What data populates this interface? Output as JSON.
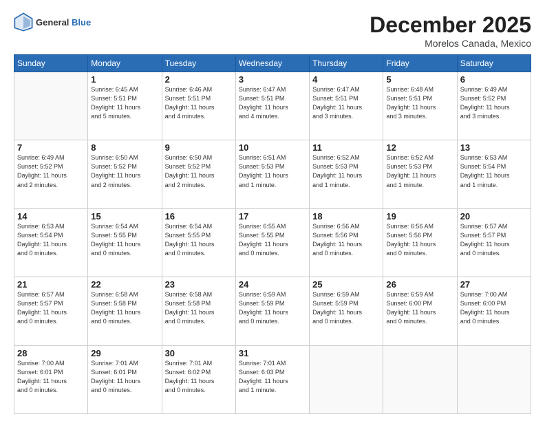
{
  "header": {
    "logo_general": "General",
    "logo_blue": "Blue",
    "month": "December 2025",
    "location": "Morelos Canada, Mexico"
  },
  "days_of_week": [
    "Sunday",
    "Monday",
    "Tuesday",
    "Wednesday",
    "Thursday",
    "Friday",
    "Saturday"
  ],
  "weeks": [
    [
      {
        "num": "",
        "info": ""
      },
      {
        "num": "1",
        "info": "Sunrise: 6:45 AM\nSunset: 5:51 PM\nDaylight: 11 hours\nand 5 minutes."
      },
      {
        "num": "2",
        "info": "Sunrise: 6:46 AM\nSunset: 5:51 PM\nDaylight: 11 hours\nand 4 minutes."
      },
      {
        "num": "3",
        "info": "Sunrise: 6:47 AM\nSunset: 5:51 PM\nDaylight: 11 hours\nand 4 minutes."
      },
      {
        "num": "4",
        "info": "Sunrise: 6:47 AM\nSunset: 5:51 PM\nDaylight: 11 hours\nand 3 minutes."
      },
      {
        "num": "5",
        "info": "Sunrise: 6:48 AM\nSunset: 5:51 PM\nDaylight: 11 hours\nand 3 minutes."
      },
      {
        "num": "6",
        "info": "Sunrise: 6:49 AM\nSunset: 5:52 PM\nDaylight: 11 hours\nand 3 minutes."
      }
    ],
    [
      {
        "num": "7",
        "info": "Sunrise: 6:49 AM\nSunset: 5:52 PM\nDaylight: 11 hours\nand 2 minutes."
      },
      {
        "num": "8",
        "info": "Sunrise: 6:50 AM\nSunset: 5:52 PM\nDaylight: 11 hours\nand 2 minutes."
      },
      {
        "num": "9",
        "info": "Sunrise: 6:50 AM\nSunset: 5:52 PM\nDaylight: 11 hours\nand 2 minutes."
      },
      {
        "num": "10",
        "info": "Sunrise: 6:51 AM\nSunset: 5:53 PM\nDaylight: 11 hours\nand 1 minute."
      },
      {
        "num": "11",
        "info": "Sunrise: 6:52 AM\nSunset: 5:53 PM\nDaylight: 11 hours\nand 1 minute."
      },
      {
        "num": "12",
        "info": "Sunrise: 6:52 AM\nSunset: 5:53 PM\nDaylight: 11 hours\nand 1 minute."
      },
      {
        "num": "13",
        "info": "Sunrise: 6:53 AM\nSunset: 5:54 PM\nDaylight: 11 hours\nand 1 minute."
      }
    ],
    [
      {
        "num": "14",
        "info": "Sunrise: 6:53 AM\nSunset: 5:54 PM\nDaylight: 11 hours\nand 0 minutes."
      },
      {
        "num": "15",
        "info": "Sunrise: 6:54 AM\nSunset: 5:55 PM\nDaylight: 11 hours\nand 0 minutes."
      },
      {
        "num": "16",
        "info": "Sunrise: 6:54 AM\nSunset: 5:55 PM\nDaylight: 11 hours\nand 0 minutes."
      },
      {
        "num": "17",
        "info": "Sunrise: 6:55 AM\nSunset: 5:55 PM\nDaylight: 11 hours\nand 0 minutes."
      },
      {
        "num": "18",
        "info": "Sunrise: 6:56 AM\nSunset: 5:56 PM\nDaylight: 11 hours\nand 0 minutes."
      },
      {
        "num": "19",
        "info": "Sunrise: 6:56 AM\nSunset: 5:56 PM\nDaylight: 11 hours\nand 0 minutes."
      },
      {
        "num": "20",
        "info": "Sunrise: 6:57 AM\nSunset: 5:57 PM\nDaylight: 11 hours\nand 0 minutes."
      }
    ],
    [
      {
        "num": "21",
        "info": "Sunrise: 6:57 AM\nSunset: 5:57 PM\nDaylight: 11 hours\nand 0 minutes."
      },
      {
        "num": "22",
        "info": "Sunrise: 6:58 AM\nSunset: 5:58 PM\nDaylight: 11 hours\nand 0 minutes."
      },
      {
        "num": "23",
        "info": "Sunrise: 6:58 AM\nSunset: 5:58 PM\nDaylight: 11 hours\nand 0 minutes."
      },
      {
        "num": "24",
        "info": "Sunrise: 6:59 AM\nSunset: 5:59 PM\nDaylight: 11 hours\nand 0 minutes."
      },
      {
        "num": "25",
        "info": "Sunrise: 6:59 AM\nSunset: 5:59 PM\nDaylight: 11 hours\nand 0 minutes."
      },
      {
        "num": "26",
        "info": "Sunrise: 6:59 AM\nSunset: 6:00 PM\nDaylight: 11 hours\nand 0 minutes."
      },
      {
        "num": "27",
        "info": "Sunrise: 7:00 AM\nSunset: 6:00 PM\nDaylight: 11 hours\nand 0 minutes."
      }
    ],
    [
      {
        "num": "28",
        "info": "Sunrise: 7:00 AM\nSunset: 6:01 PM\nDaylight: 11 hours\nand 0 minutes."
      },
      {
        "num": "29",
        "info": "Sunrise: 7:01 AM\nSunset: 6:01 PM\nDaylight: 11 hours\nand 0 minutes."
      },
      {
        "num": "30",
        "info": "Sunrise: 7:01 AM\nSunset: 6:02 PM\nDaylight: 11 hours\nand 0 minutes."
      },
      {
        "num": "31",
        "info": "Sunrise: 7:01 AM\nSunset: 6:03 PM\nDaylight: 11 hours\nand 1 minute."
      },
      {
        "num": "",
        "info": ""
      },
      {
        "num": "",
        "info": ""
      },
      {
        "num": "",
        "info": ""
      }
    ]
  ]
}
